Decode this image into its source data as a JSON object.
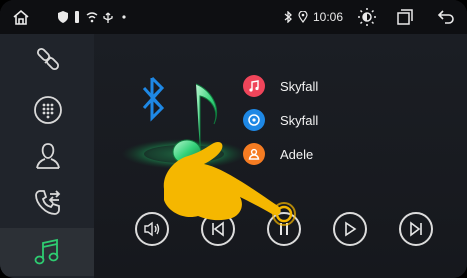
{
  "statusbar": {
    "time": "10:06",
    "icons": [
      "home-icon",
      "shield-icon",
      "usb-icon",
      "wifi-icon",
      "usb-trident-icon",
      "dot-icon",
      "bluetooth-icon",
      "location-icon",
      "brightness-icon",
      "recent-apps-icon",
      "back-arrow-icon"
    ]
  },
  "sidebar": {
    "items": [
      {
        "name": "link-icon",
        "active": false
      },
      {
        "name": "dialpad-icon",
        "active": false
      },
      {
        "name": "contacts-icon",
        "active": false
      },
      {
        "name": "call-transfer-icon",
        "active": false
      },
      {
        "name": "music-note-icon",
        "active": true
      }
    ]
  },
  "songs": [
    {
      "title": "Skyfall",
      "color": "#f0455a",
      "icon": "music-note-icon"
    },
    {
      "title": "Skyfall",
      "color": "#1e88e5",
      "icon": "disc-icon"
    },
    {
      "title": "Adele",
      "color": "#f57c22",
      "icon": "person-icon"
    }
  ],
  "controls": [
    "volume-icon",
    "previous-icon",
    "pause-icon",
    "play-icon",
    "next-icon"
  ],
  "colors": {
    "accent_green": "#2ecc71",
    "bluetooth_blue": "#1e88e5",
    "hand_yellow": "#f5b700"
  }
}
